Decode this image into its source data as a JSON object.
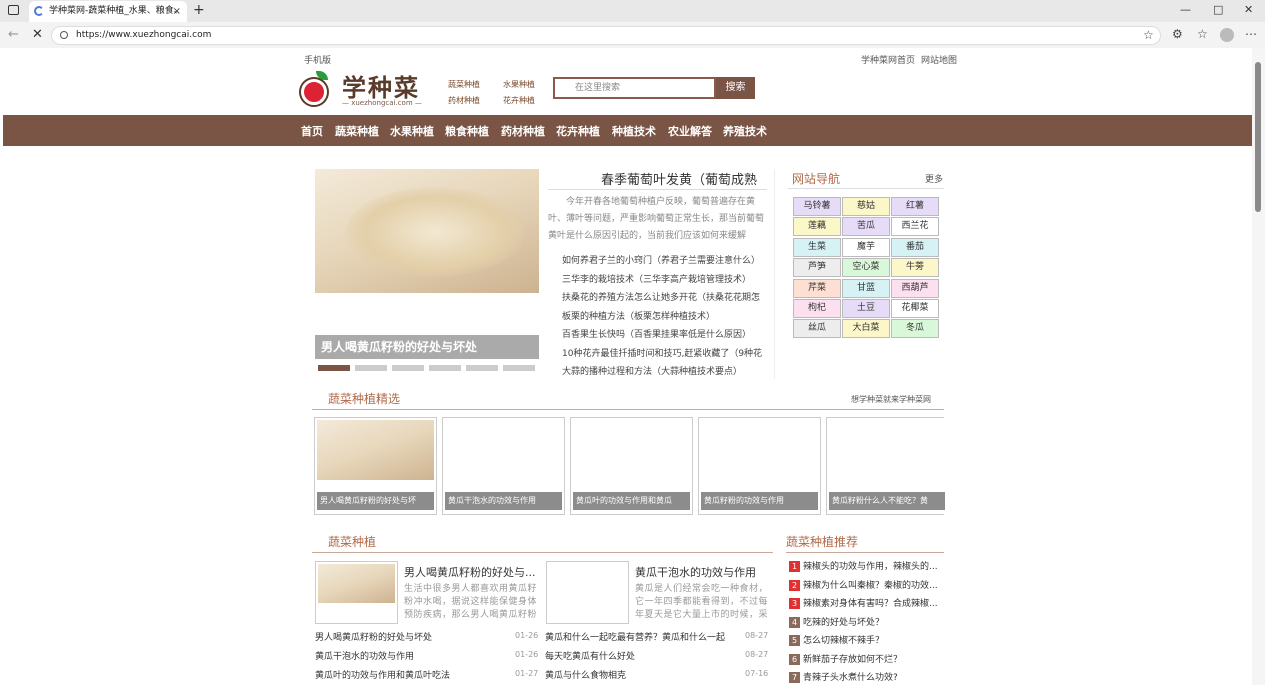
{
  "browser": {
    "tab_title": "学种菜网-蔬菜种植_水果、粮食、",
    "tab_close": "×",
    "new_tab": "+",
    "url": "https://www.xuezhongcai.com",
    "minimize": "—",
    "maximize": "□",
    "close": "✕"
  },
  "topbar": {
    "mobile": "手机版",
    "home": "学种菜网首页",
    "sitemap": "网站地图"
  },
  "header": {
    "brand": "学种菜",
    "brand_sub": "— xuezhongcai.com —",
    "quick_links": [
      "蔬菜种植",
      "水果种植",
      "药材种植",
      "花卉种植"
    ],
    "search_placeholder": "在这里搜索",
    "search_button": "搜索"
  },
  "nav": {
    "items": [
      "首页",
      "蔬菜种植",
      "水果种植",
      "粮食种植",
      "药材种植",
      "花卉种植",
      "种植技术",
      "农业解答",
      "养殖技术"
    ]
  },
  "slider": {
    "caption": "男人喝黄瓜籽粉的好处与坏处",
    "active_index": 0
  },
  "featured": {
    "headline": "春季葡萄叶发黄（葡萄成熟",
    "summary": "今年开春各地葡萄种植户反映，葡萄普遍存在黄叶、薄叶等问题，严重影响葡萄正常生长，那当前葡萄黄叶是什么原因引起的，当前我们应该如何来缓解",
    "list": [
      "如何养君子兰的小窍门（养君子兰需要注意什么）",
      "三华李的栽培技术（三华李高产栽培管理技术）",
      "扶桑花的养殖方法怎么让她多开花（扶桑花花期怎",
      "板栗的种植方法（板栗怎样种植技术）",
      "百香果生长快吗（百香果挂果率低是什么原因）",
      "10种花卉最佳扦插时间和技巧,赶紧收藏了（9种花",
      "大蒜的播种过程和方法（大蒜种植技术要点）"
    ]
  },
  "site_nav": {
    "title": "网站导航",
    "more": "更多",
    "items": [
      {
        "label": "马铃薯",
        "color": "#e6dcf7"
      },
      {
        "label": "慈姑",
        "color": "#fbf7c8"
      },
      {
        "label": "红薯",
        "color": "#e6dcf7"
      },
      {
        "label": "莲藕",
        "color": "#fbf7c8"
      },
      {
        "label": "苦瓜",
        "color": "#e6dcf7"
      },
      {
        "label": "西兰花",
        "color": "#ffffff"
      },
      {
        "label": "生菜",
        "color": "#d6f2f5"
      },
      {
        "label": "魔芋",
        "color": "#ffffff"
      },
      {
        "label": "番茄",
        "color": "#d6f2f5"
      },
      {
        "label": "芦笋",
        "color": "#ededed"
      },
      {
        "label": "空心菜",
        "color": "#d9f7d9"
      },
      {
        "label": "牛蒡",
        "color": "#fbf7c8"
      },
      {
        "label": "芹菜",
        "color": "#fde0d3"
      },
      {
        "label": "甘蓝",
        "color": "#d6f2f5"
      },
      {
        "label": "西葫芦",
        "color": "#fde0f0"
      },
      {
        "label": "枸杞",
        "color": "#fde0f0"
      },
      {
        "label": "土豆",
        "color": "#e6dcf7"
      },
      {
        "label": "花椰菜",
        "color": "#ffffff"
      },
      {
        "label": "丝瓜",
        "color": "#ededed"
      },
      {
        "label": "大白菜",
        "color": "#fbf7c8"
      },
      {
        "label": "冬瓜",
        "color": "#d9f7d9"
      }
    ]
  },
  "veg_select": {
    "title": "蔬菜种植精选",
    "right": "想学种菜就来学种菜网",
    "thumbs": [
      {
        "caption": "男人喝黄瓜籽粉的好处与坏",
        "has_image": true
      },
      {
        "caption": "黄瓜干泡水的功效与作用",
        "has_image": false
      },
      {
        "caption": "黄瓜叶的功效与作用和黄瓜",
        "has_image": false
      },
      {
        "caption": "黄瓜籽粉的功效与作用",
        "has_image": false
      },
      {
        "caption": "黄瓜籽粉什么人不能吃？黄",
        "has_image": false
      }
    ]
  },
  "veg_plant": {
    "title": "蔬菜种植",
    "cards": [
      {
        "title": "男人喝黄瓜籽粉的好处与...",
        "desc": "生活中很多男人都喜欢用黄瓜籽粉冲水喝，据说这样能保健身体预防疾病，那么男人喝黄瓜籽粉"
      },
      {
        "title": "黄瓜干泡水的功效与作用",
        "desc": "黄瓜是人们经常会吃一种食材，它一年四季都能看得到，不过每年夏天是它大量上市的时候，采"
      }
    ],
    "articles_left": [
      {
        "title": "男人喝黄瓜籽粉的好处与坏处",
        "date": "01-26"
      },
      {
        "title": "黄瓜干泡水的功效与作用",
        "date": "01-26"
      },
      {
        "title": "黄瓜叶的功效与作用和黄瓜叶吃法",
        "date": "01-27"
      }
    ],
    "articles_right": [
      {
        "title": "黄瓜和什么一起吃最有营养？黄瓜和什么一起",
        "date": "08-27"
      },
      {
        "title": "每天吃黄瓜有什么好处",
        "date": "08-27"
      },
      {
        "title": "黄瓜与什么食物相克",
        "date": "07-16"
      }
    ]
  },
  "recommend": {
    "title": "蔬菜种植推荐",
    "items": [
      {
        "n": "1",
        "title": "辣椒头的功效与作用，辣椒头的...",
        "color": "#e03030"
      },
      {
        "n": "2",
        "title": "辣椒为什么叫秦椒？秦椒的功效...",
        "color": "#e03030"
      },
      {
        "n": "3",
        "title": "辣椒素对身体有害吗？合成辣椒...",
        "color": "#e03030"
      },
      {
        "n": "4",
        "title": "吃辣的好处与坏处？",
        "color": "#8a6a5a"
      },
      {
        "n": "5",
        "title": "怎么切辣椒不辣手？",
        "color": "#8a6a5a"
      },
      {
        "n": "6",
        "title": "新鲜茄子存放如何不烂？",
        "color": "#8a6a5a"
      },
      {
        "n": "7",
        "title": "青辣子头水煮什么功效?",
        "color": "#8a6a5a"
      }
    ]
  }
}
